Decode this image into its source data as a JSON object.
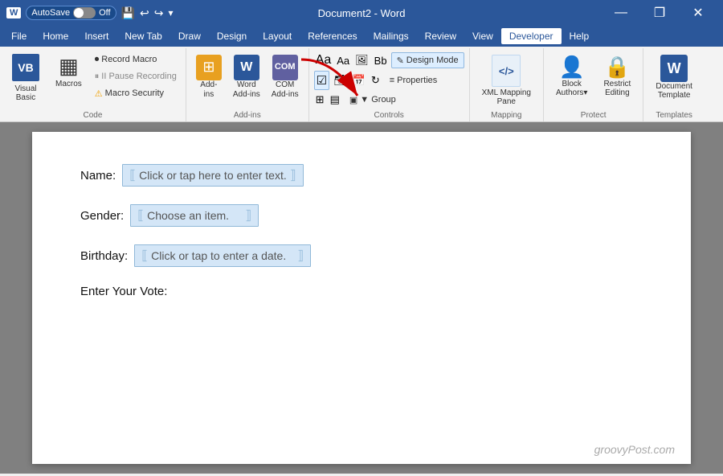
{
  "titleBar": {
    "autosave_label": "AutoSave",
    "autosave_state": "Off",
    "title": "Document2 - Word",
    "window_controls": [
      "—",
      "❐",
      "✕"
    ]
  },
  "menuBar": {
    "items": [
      "File",
      "Home",
      "Insert",
      "New Tab",
      "Draw",
      "Design",
      "Layout",
      "References",
      "Mailings",
      "Review",
      "View",
      "Developer",
      "Help"
    ],
    "active": "Developer"
  },
  "ribbon": {
    "groups": [
      {
        "name": "Code",
        "buttons": [
          {
            "id": "visual-basic",
            "label": "Visual\nBasic",
            "icon": "VB"
          },
          {
            "id": "macros",
            "label": "Macros",
            "icon": "▦"
          },
          {
            "id": "record-macro",
            "label": "Record Macro"
          },
          {
            "id": "pause-recording",
            "label": "II Pause Recording"
          },
          {
            "id": "macro-security",
            "label": "⚠ Macro Security"
          }
        ]
      },
      {
        "name": "Add-ins",
        "buttons": [
          {
            "id": "add-ins",
            "label": "Add-\nins",
            "icon": "🧩"
          },
          {
            "id": "word-add-ins",
            "label": "Word\nAdd-ins",
            "icon": "W"
          },
          {
            "id": "com-add-ins",
            "label": "COM\nAdd-ins",
            "icon": "⚙"
          }
        ]
      },
      {
        "name": "Controls",
        "buttons": [
          {
            "id": "design-mode",
            "label": "Design Mode",
            "active": true
          },
          {
            "id": "properties",
            "label": "Properties"
          },
          {
            "id": "group",
            "label": "▼ Group"
          }
        ]
      },
      {
        "name": "Mapping",
        "buttons": [
          {
            "id": "xml-mapping-pane",
            "label": "XML Mapping\nPane",
            "icon": "</>"
          }
        ]
      },
      {
        "name": "Protect",
        "buttons": [
          {
            "id": "block-authors",
            "label": "Block\nAuthors",
            "icon": "👤"
          },
          {
            "id": "restrict-editing",
            "label": "Restrict\nEditing",
            "icon": "🔒"
          }
        ]
      },
      {
        "name": "Templates",
        "buttons": [
          {
            "id": "document-template",
            "label": "Document\nTemplate",
            "icon": "W"
          }
        ]
      }
    ]
  },
  "document": {
    "fields": [
      {
        "label": "Name:",
        "placeholder": "Click or tap here to enter text.",
        "type": "text"
      },
      {
        "label": "Gender:",
        "placeholder": "Choose an item.",
        "type": "dropdown"
      },
      {
        "label": "Birthday:",
        "placeholder": "Click or tap to enter a date.",
        "type": "date"
      },
      {
        "label": "Enter Your Vote:",
        "placeholder": "",
        "type": "label"
      }
    ]
  },
  "watermark": "groovyPost.com"
}
